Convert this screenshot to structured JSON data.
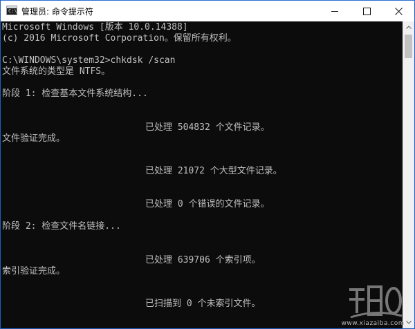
{
  "window": {
    "title": "管理员: 命令提示符",
    "icon": "cmd-icon",
    "icon_label": "C:\\",
    "controls": [
      "minimize-icon",
      "maximize-icon",
      "close-icon"
    ]
  },
  "console": {
    "lines": [
      "Microsoft Windows [版本 10.0.14388]",
      "(c) 2016 Microsoft Corporation。保留所有权利。",
      "",
      "C:\\WINDOWS\\system32>chkdsk /scan",
      "文件系统的类型是 NTFS。",
      "",
      "阶段 1: 检查基本文件系统结构...",
      "",
      "",
      "已处理 504832 个文件记录。",
      "文件验证完成。",
      "",
      "",
      "已处理 21072 个大型文件记录。",
      "",
      "",
      "已处理 0 个错误的文件记录。",
      "",
      "阶段 2: 检查文件名链接...",
      "",
      "",
      "已处理 639706 个索引项。",
      "索引验证完成。",
      "",
      "",
      "已扫描到 0 个未索引文件。"
    ]
  },
  "watermark": {
    "url": "www.xiazaiba.com"
  },
  "colors": {
    "background": "#0c0c0c",
    "text": "#c0c0c0",
    "titlebar": "#ffffff",
    "border": "#1f5fbf"
  }
}
